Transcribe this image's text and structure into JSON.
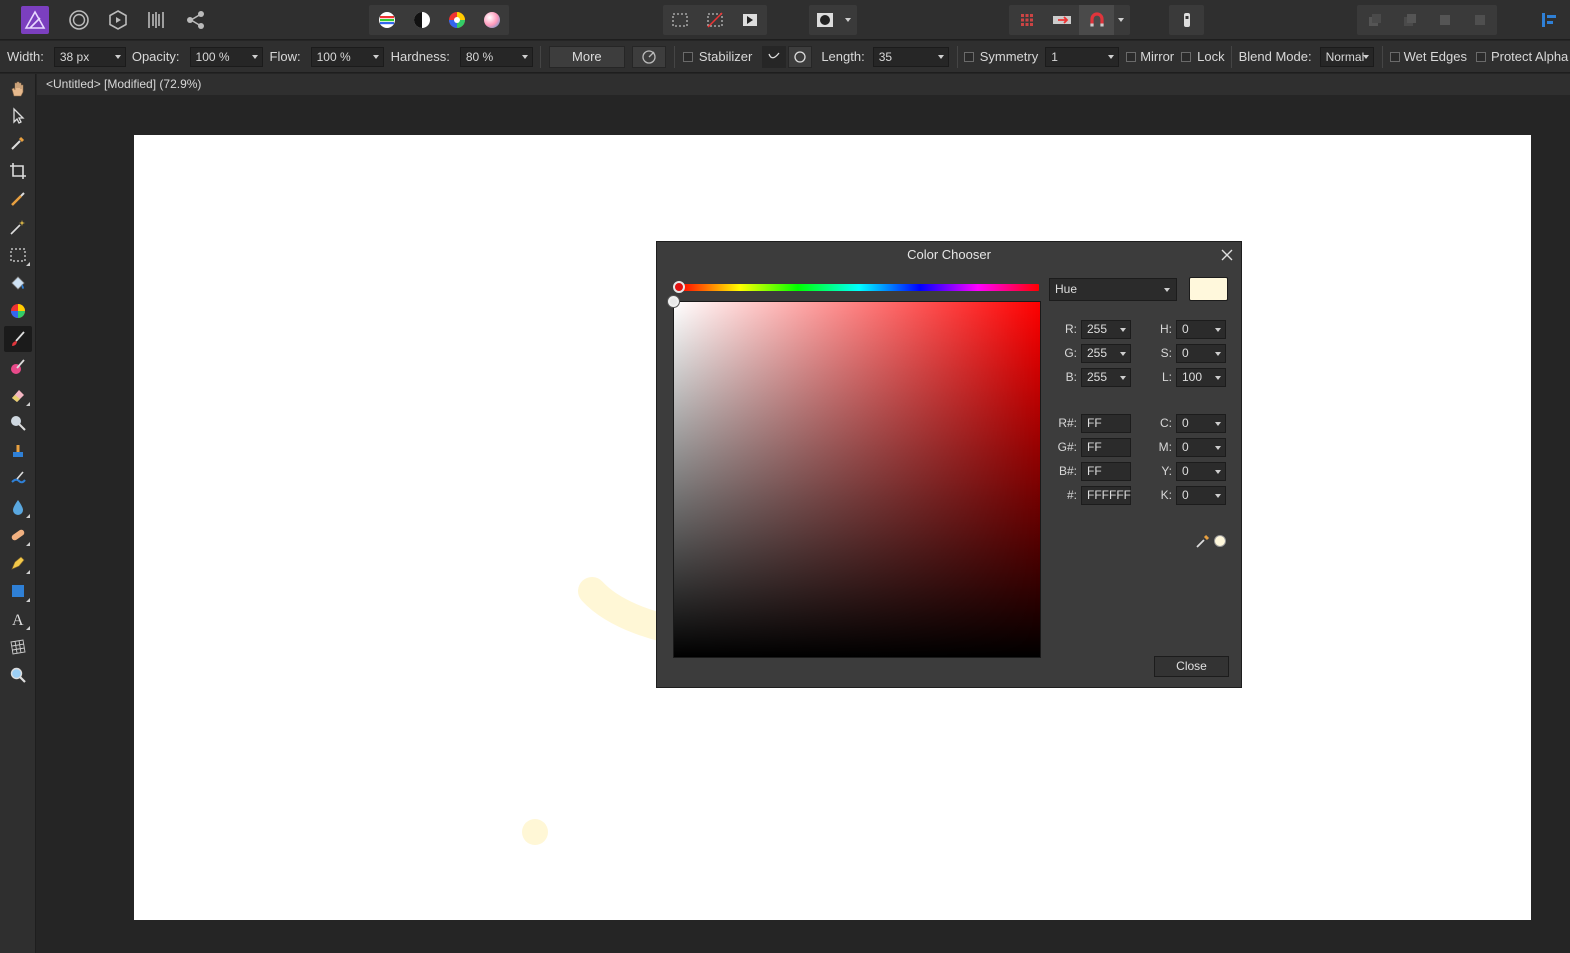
{
  "document": {
    "title": "<Untitled> [Modified] (72.9%)"
  },
  "context_toolbar": {
    "width_label": "Width:",
    "width_value": "38 px",
    "opacity_label": "Opacity:",
    "opacity_value": "100 %",
    "flow_label": "Flow:",
    "flow_value": "100 %",
    "hardness_label": "Hardness:",
    "hardness_value": "80 %",
    "more_label": "More",
    "stabilizer_label": "Stabilizer",
    "length_label": "Length:",
    "length_value": "35",
    "symmetry_label": "Symmetry",
    "symmetry_value": "1",
    "mirror_label": "Mirror",
    "lock_label": "Lock",
    "blend_mode_label": "Blend Mode:",
    "blend_mode_value": "Normal",
    "wet_edges_label": "Wet Edges",
    "protect_alpha_label": "Protect Alpha"
  },
  "color_chooser": {
    "title": "Color Chooser",
    "mode": "Hue",
    "current_color": "#FFF8DC",
    "rgb": {
      "r_label": "R:",
      "r": "255",
      "g_label": "G:",
      "g": "255",
      "b_label": "B:",
      "b": "255"
    },
    "hsl": {
      "h_label": "H:",
      "h": "0",
      "s_label": "S:",
      "s": "0",
      "l_label": "L:",
      "l": "100"
    },
    "hex_channels": {
      "r_label": "R#:",
      "r": "FF",
      "g_label": "G#:",
      "g": "FF",
      "b_label": "B#:",
      "b": "FF"
    },
    "hex_label": "#:",
    "hex": "FFFFFF",
    "cmyk": {
      "c_label": "C:",
      "c": "0",
      "m_label": "M:",
      "m": "0",
      "y_label": "Y:",
      "y": "0",
      "k_label": "K:",
      "k": "0"
    },
    "close_label": "Close"
  },
  "colors": {
    "brand": "#7b3fbf",
    "stroke": "#fff7d6",
    "accent_blue": "#2f80d6"
  },
  "icons": {
    "top": [
      "affinity-photo-logo",
      "photo-persona-icon",
      "liquify-persona-icon",
      "develop-persona-icon",
      "export-persona-icon",
      "share-icon",
      "channels-icon",
      "contrast-icon",
      "color-wheel-icon",
      "gradient-sphere-icon",
      "marquee-icon",
      "deselect-icon",
      "invert-selection-icon",
      "mask-icon",
      "grid-icon",
      "move-arrange-icon",
      "snapping-magnet-icon",
      "assistant-icon",
      "studio-panel-icon"
    ]
  }
}
